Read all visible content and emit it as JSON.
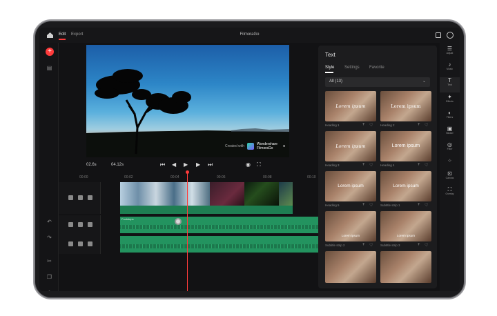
{
  "topbar": {
    "tab_edit": "Edit",
    "tab_export": "Export",
    "title": "FilmoraGo"
  },
  "preview": {
    "watermark_created": "Created with",
    "watermark_brand": "Wondershare\nFilmoraGo"
  },
  "playback": {
    "current_time": "02.6s",
    "total_time": "04.12s"
  },
  "ruler": {
    "ticks": [
      "00:00",
      "00:02",
      "00:04",
      "00:06",
      "00:08",
      "00:10"
    ]
  },
  "audio_label": "Footsteps",
  "panel": {
    "title": "Text",
    "tabs": [
      {
        "label": "Style",
        "active": true
      },
      {
        "label": "Settings",
        "active": false
      },
      {
        "label": "Favorite",
        "active": false
      }
    ],
    "filter": "All (13)",
    "tiles": [
      {
        "overlay": "Lorem ipsum",
        "caption": "Heading 1"
      },
      {
        "overlay": "Lorem ipsum",
        "caption": "Heading 2"
      },
      {
        "overlay": "Lorem ipsum",
        "caption": "Heading 3"
      },
      {
        "overlay": "Lorem ipsum",
        "caption": "Heading 4"
      },
      {
        "overlay": "Lorem ipsum",
        "caption": "Heading 5"
      },
      {
        "overlay": "Lorem ipsum",
        "caption": "Subtitle strip 1"
      },
      {
        "overlay": "Lorem ipsum",
        "caption": "Subtitle strip 2"
      },
      {
        "overlay": "Lorem ipsum",
        "caption": "Subtitle strip 3"
      },
      {
        "overlay": "",
        "caption": ""
      },
      {
        "overlay": "",
        "caption": ""
      }
    ]
  },
  "rightrail": [
    {
      "label": "Adjust",
      "icon": "sliders-icon"
    },
    {
      "label": "Music",
      "icon": "music-icon"
    },
    {
      "label": "Text",
      "icon": "text-icon",
      "active": true
    },
    {
      "label": "Effects",
      "icon": "effects-icon"
    },
    {
      "label": "Filters",
      "icon": "filters-icon"
    },
    {
      "label": "Sticker",
      "icon": "sticker-icon"
    },
    {
      "label": "Filter",
      "icon": "filter-icon"
    },
    {
      "label": "",
      "icon": "transition-icon"
    },
    {
      "label": "Canvas",
      "icon": "canvas-icon"
    },
    {
      "label": "Overlay",
      "icon": "overlay-icon"
    }
  ],
  "colors": {
    "accent": "#ff3b3b",
    "track_green": "#23935f"
  }
}
